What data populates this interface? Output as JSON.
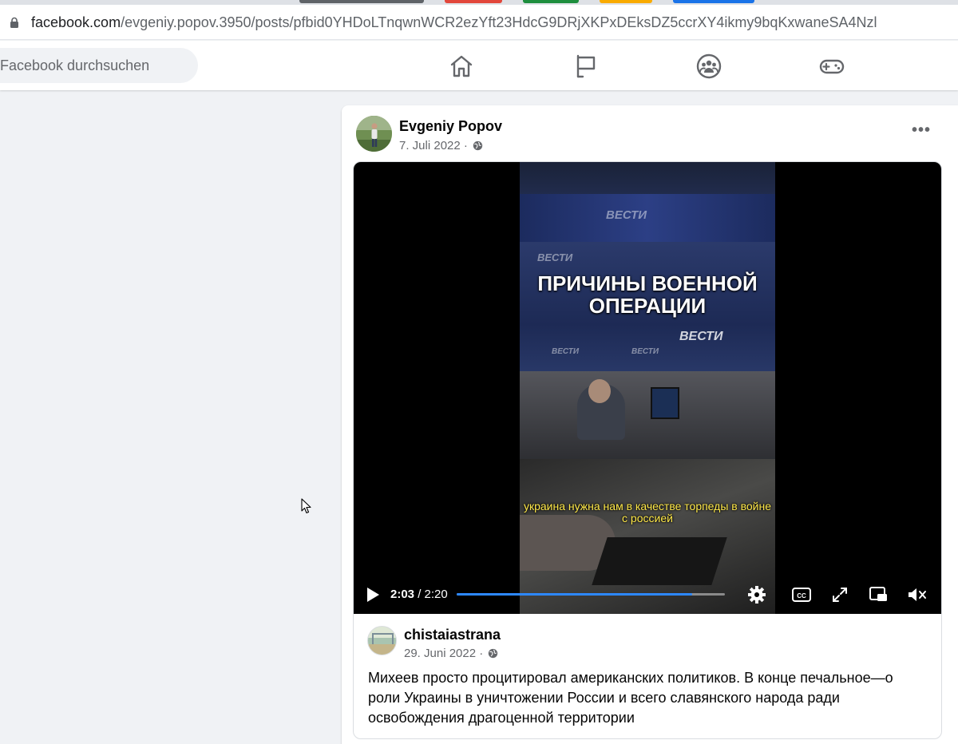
{
  "browser": {
    "url_host": "facebook.com",
    "url_path": "/evgeniy.popov.3950/posts/pfbid0YHDoLTnqwnWCR2ezYft23HdcG9DRjXKPxDEksDZ5ccrXY4ikmy9bqKxwaneSA4Nzl",
    "icons": {
      "lock": "lock-icon"
    }
  },
  "topbar": {
    "search_placeholder": "Facebook durchsuchen",
    "nav_icons": [
      "home-icon",
      "flag-icon",
      "groups-icon",
      "gaming-icon"
    ]
  },
  "post": {
    "author": "Evgeniy Popov",
    "date": "7. Juli 2022",
    "separator": "·",
    "privacy_icon": "globe-icon",
    "more_label": "•••",
    "video": {
      "overlay_title": "ПРИЧИНЫ ВОЕННОЙ ОПЕРАЦИИ",
      "subtitle": "украина нужна нам в качестве торпеды в войне с россией",
      "current_time": "2:03",
      "duration": "2:20",
      "progress_fraction": 0.879,
      "accent_color": "#2d88ff",
      "controls": [
        "play-icon",
        "settings-icon",
        "captions-icon",
        "fullscreen-icon",
        "picture-in-picture-icon",
        "muted-icon"
      ]
    },
    "shared": {
      "author": "chistaiastrana",
      "date": "29. Juni 2022",
      "separator": "·",
      "text": "Михеев просто процитировал американских политиков. В конце печальное—о роли Украины в уничтожении России и всего славянского народа ради освобождения драгоценной территории"
    }
  },
  "colors": {
    "page_bg": "#f0f2f5",
    "card_bg": "#ffffff",
    "secondary_text": "#65676b"
  }
}
